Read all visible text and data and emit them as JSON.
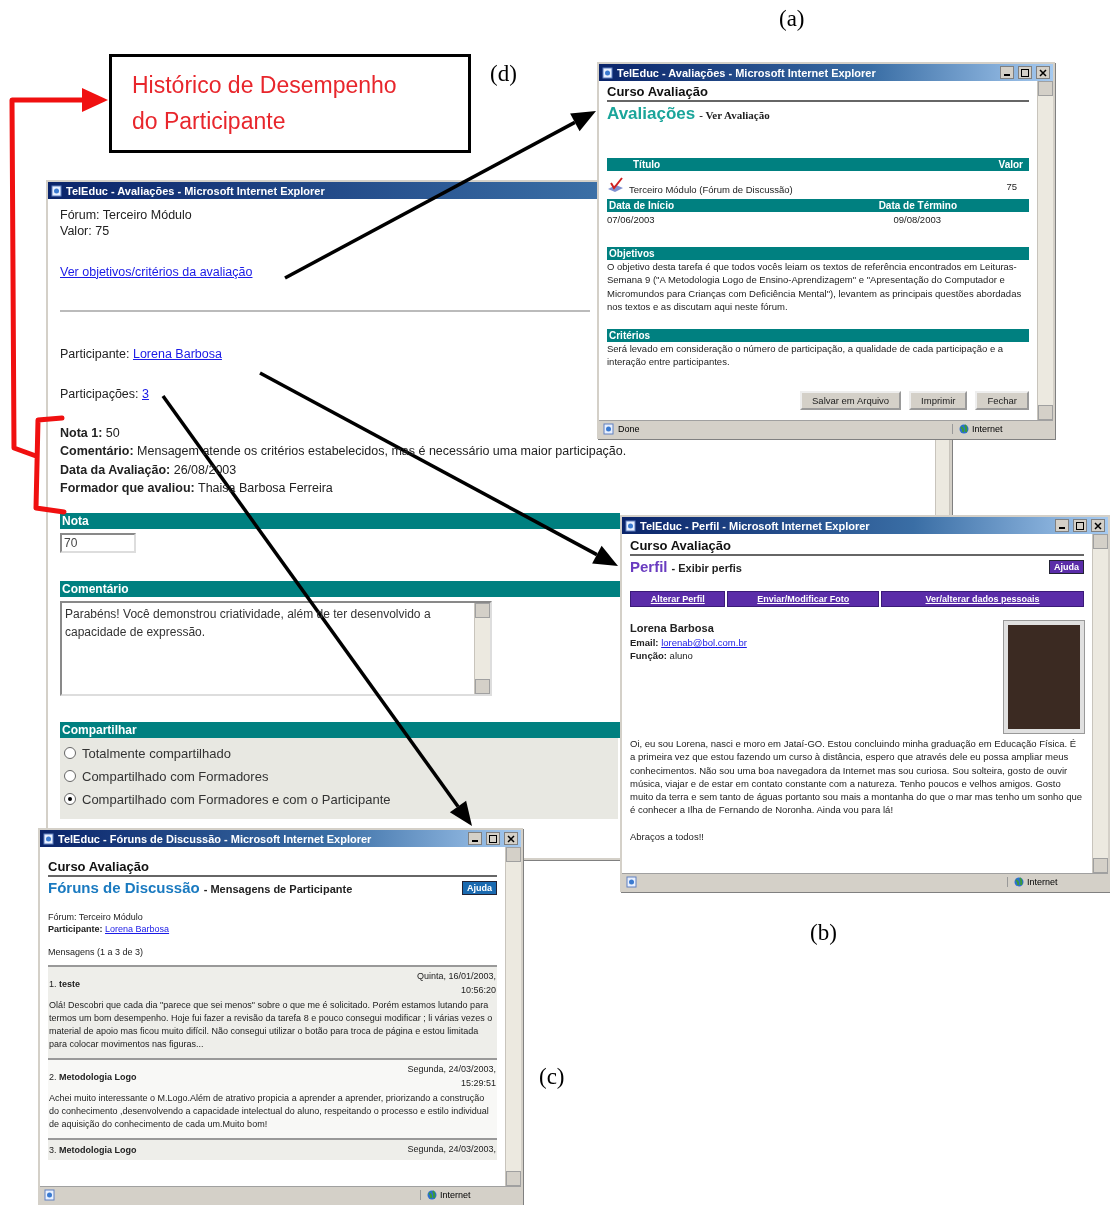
{
  "panel_labels": [
    "(a)",
    "(d)",
    "(b)",
    "(c)"
  ],
  "callout": {
    "lines": [
      "Histórico de Desempenho",
      "do Participante"
    ]
  },
  "evaluation_window": {
    "title": "TelEduc - Avaliações - Microsoft Internet Explorer",
    "forum": "Fórum: Terceiro Módulo",
    "value": "Valor: 75",
    "criteria_link": "Ver objetivos/critérios da avaliação",
    "participant_label": "Participante:",
    "participant_link": "Lorena Barbosa",
    "participations_label": "Participações:",
    "participations_link": "3",
    "history": [
      "**Nota 1:** 50",
      "**Comentário:** Mensagem atende os critérios estabelecidos, mas é necessário uma maior participação.",
      "**Data da Avaliação:** 26/08/2003",
      "**Formador que avaliou:** Thaisa Barbosa Ferreira"
    ],
    "grade_header": "Nota",
    "grade_value": "70",
    "comment_header": "Comentário",
    "comment_value": "Parabéns! Você demonstrou criatividade, além de ter desenvolvido a capacidade de expressão.",
    "share_header": "Compartilhar",
    "share_options": [
      {
        "label": "Totalmente compartilhado",
        "selected": false
      },
      {
        "label": "Compartilhado com Formadores",
        "selected": false
      },
      {
        "label": "Compartilhado com Formadores e com o Participante",
        "selected": true
      }
    ]
  },
  "assessment_window": {
    "title": "TelEduc - Avaliações - Microsoft Internet Explorer",
    "course": "Curso Avaliação",
    "section": "Avaliações",
    "subsection": "- Ver Avaliação",
    "columns": [
      "Título",
      "Valor"
    ],
    "item": {
      "title": "Terceiro Módulo (Fórum de Discussão)",
      "value": "75"
    },
    "date_columns": [
      "Data de Início",
      "Data de Término"
    ],
    "dates": [
      "07/06/2003",
      "09/08/2003"
    ],
    "objectives_header": "Objetivos",
    "objectives": "O objetivo desta tarefa é que todos vocês leiam os textos de referência encontrados em Leituras-Semana 9 (\"A Metodologia Logo de Ensino-Aprendizagem\" e \"Apresentação do Computador e Micromundos para Crianças com Deficiência Mental\"), levantem as principais questões abordadas nos textos e as discutam aqui neste fórum.",
    "criteria_header": "Critérios",
    "criteria": "Será levado em consideração o número de participação, a qualidade de cada participação e a interação entre participantes.",
    "buttons": [
      "Salvar em Arquivo",
      "Imprimir",
      "Fechar"
    ],
    "status": "Done",
    "zone": "Internet"
  },
  "profile_window": {
    "title": "TelEduc - Perfil - Microsoft Internet Explorer",
    "course": "Curso Avaliação",
    "section": "Perfil",
    "subsection": "- Exibir perfis",
    "help": "Ajuda",
    "tabs": [
      "Alterar Perfil",
      "Enviar/Modificar Foto",
      "Ver/alterar dados pessoais"
    ],
    "name": "Lorena Barbosa",
    "email_label": "Email:",
    "email": "lorenab@bol.com.br",
    "role": "**Função:** aluno",
    "bio": "Oi, eu sou Lorena, nasci e moro em Jataí-GO. Estou concluindo minha graduação em Educação Física. É a primeira vez que estou fazendo um curso à distância, espero que através dele eu possa ampliar meus conhecimentos. Não sou uma boa navegadora da Internet mas sou curiosa. Sou solteira, gosto de ouvir música, viajar e de estar em contato constante com a natureza. Tenho poucos e velhos amigos. Gosto muito da terra e sem tanto de águas portanto sou mais a montanha do que o mar mas tenho um sonho que é conhecer a Ilha de Fernando de Noronha. Ainda vou para lá!",
    "closing": "Abraços a todos!!",
    "zone": "Internet"
  },
  "forum_window": {
    "title": "TelEduc - Fóruns de Discussão - Microsoft Internet Explorer",
    "course": "Curso Avaliação",
    "section": "Fóruns de Discussão",
    "subsection": "- Mensagens de Participante",
    "help": "Ajuda",
    "forum": "Fórum: Terceiro Módulo",
    "participant_label": "Participante:",
    "participant_link": "Lorena Barbosa",
    "count": "Mensagens (1 a 3 de 3)",
    "messages": [
      {
        "number": "1.",
        "subject": "teste",
        "date": "Quinta, 16/01/2003,",
        "time": "10:56:20",
        "body": "Olá! Descobri que cada dia \"parece que sei menos\" sobre o que me é solicitado. Porém estamos lutando para termos um bom desempenho. Hoje fui fazer a revisão da tarefa 8 e pouco consegui modificar ; li várias vezes o material de apoio mas ficou muito difícil. Não consegui utilizar o botão para troca de página e estou limitada para colocar movimentos nas figuras..."
      },
      {
        "number": "2.",
        "subject": "Metodologia Logo",
        "date": "Segunda, 24/03/2003,",
        "time": "15:29:51",
        "body": "Achei muito interessante o M.Logo.Além de atrativo propicia a aprender a aprender, priorizando a construção do conhecimento ,desenvolvendo a capacidade intelectual do aluno, respeitando o processo e estilo individual de aquisição do conhecimento de cada um.Muito bom!"
      },
      {
        "number": "3.",
        "subject": "Metodologia Logo",
        "date": "Segunda, 24/03/2003,"
      }
    ],
    "zone": "Internet"
  }
}
